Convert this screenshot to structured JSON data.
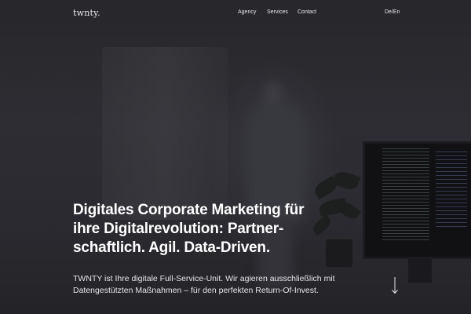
{
  "header": {
    "logo": "twnty.",
    "nav": [
      {
        "label": "Agency"
      },
      {
        "label": "Services"
      },
      {
        "label": "Contact"
      }
    ],
    "language_switch": "De/En"
  },
  "hero": {
    "headline_lines": [
      "Digitales Corporate Marketing für",
      "ihre Digitalrevolution: Partner-",
      "schaftlich. Agil. Data-Driven."
    ],
    "intro_lines": [
      "TWNTY ist Ihre digitale Full-Service-Unit. Wir agieren ausschließlich mit",
      "Datengestützten Maßnahmen – für den perfekten Return-Of-Invest."
    ],
    "scroll_icon": "arrow-down-icon"
  },
  "colors": {
    "background": "#2a2a2e",
    "text": "#ffffff"
  }
}
